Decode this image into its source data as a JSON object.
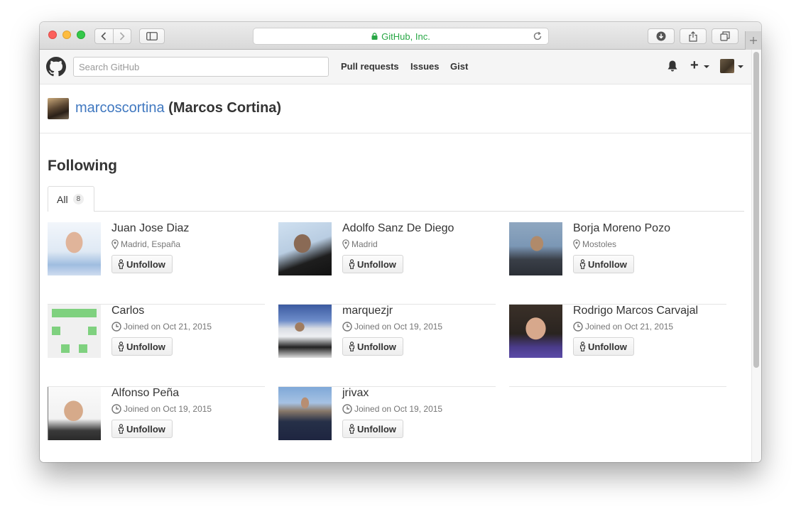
{
  "browser": {
    "url_text": "GitHub, Inc."
  },
  "header": {
    "search_placeholder": "Search GitHub",
    "nav": [
      "Pull requests",
      "Issues",
      "Gist"
    ],
    "plus_label": "+"
  },
  "profile": {
    "login": "marcoscortina",
    "full_name": "(Marcos Cortina)"
  },
  "following": {
    "title": "Following",
    "tab_label": "All",
    "tab_count": "8",
    "unfollow_label": "Unfollow",
    "users": [
      {
        "name": "Juan Jose Diaz",
        "meta": "Madrid, España",
        "meta_icon": "location-icon"
      },
      {
        "name": "Adolfo Sanz De Diego",
        "meta": "Madrid",
        "meta_icon": "location-icon"
      },
      {
        "name": "Borja Moreno Pozo",
        "meta": "Mostoles",
        "meta_icon": "location-icon"
      },
      {
        "name": "Carlos",
        "meta": "Joined on Oct 21, 2015",
        "meta_icon": "clock-icon"
      },
      {
        "name": "marquezjr",
        "meta": "Joined on Oct 19, 2015",
        "meta_icon": "clock-icon"
      },
      {
        "name": "Rodrigo Marcos Carvajal",
        "meta": "Joined on Oct 21, 2015",
        "meta_icon": "clock-icon"
      },
      {
        "name": "Alfonso Peña",
        "meta": "Joined on Oct 19, 2015",
        "meta_icon": "clock-icon"
      },
      {
        "name": "jrivax",
        "meta": "Joined on Oct 19, 2015",
        "meta_icon": "clock-icon"
      }
    ]
  },
  "colors": {
    "link": "#4078c0",
    "secure": "#28a745"
  }
}
